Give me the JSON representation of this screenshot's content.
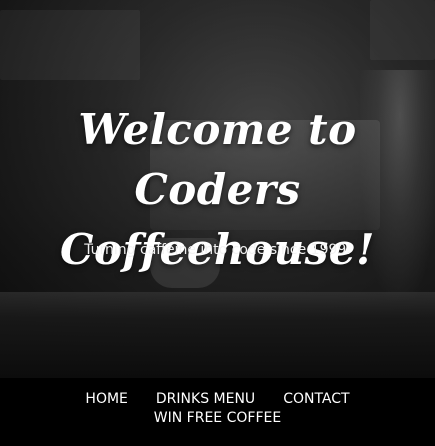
{
  "hero": {
    "title": "Welcome to Coders Coffeehouse!",
    "subtitle": "Turning caffeine into code since 1999."
  },
  "nav": {
    "items": [
      {
        "label": "HOME"
      },
      {
        "label": "DRINKS MENU"
      },
      {
        "label": "CONTACT"
      },
      {
        "label": "WIN FREE COFFEE"
      }
    ]
  },
  "colors": {
    "nav_background": "#000000",
    "text": "#ffffff"
  }
}
